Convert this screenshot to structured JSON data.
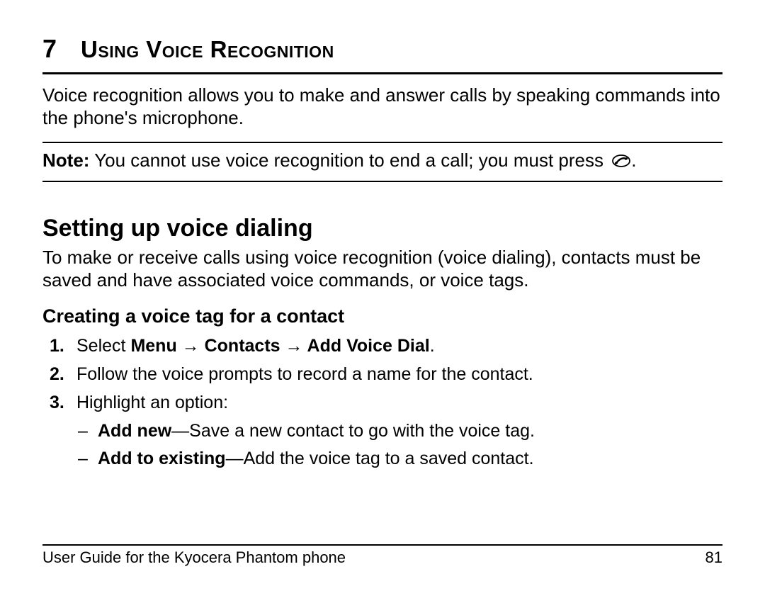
{
  "chapter": {
    "number": "7",
    "title": "Using Voice Recognition"
  },
  "intro": "Voice recognition allows you to make and answer calls by speaking commands into the phone's microphone.",
  "note": {
    "label": "Note:",
    "text": " You cannot use voice recognition to end a call; you must press ",
    "period": "."
  },
  "section_heading": "Setting up voice dialing",
  "section_body": "To make or receive calls using voice recognition (voice dialing), contacts must be saved and have associated voice commands, or voice tags.",
  "subsection_heading": "Creating a voice tag for a contact",
  "steps": {
    "s1_a": "Select ",
    "s1_b": "Menu → Contacts → Add Voice Dial",
    "s1_c": ".",
    "s2": "Follow the voice prompts to record a name for the contact.",
    "s3": "Highlight an option:",
    "sub1_a": "Add new",
    "sub1_b": "—Save a new contact to go with the voice tag.",
    "sub2_a": "Add to existing",
    "sub2_b": "—Add the voice tag to a saved contact."
  },
  "footer": {
    "left": "User Guide for the Kyocera Phantom phone",
    "right": "81"
  }
}
